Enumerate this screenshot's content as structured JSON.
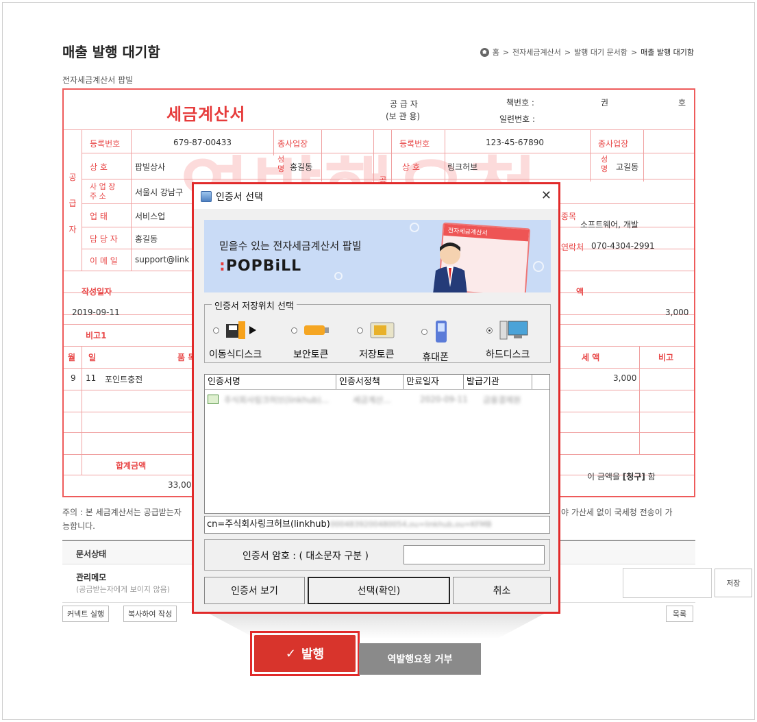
{
  "page": {
    "title": "매출 발행 대기함",
    "subtitle": "전자세금계산서 팝빌",
    "breadcrumb": [
      "홈",
      ">",
      "전자세금계산서",
      ">",
      "발행 대기 문서함",
      ">",
      "매출 발행 대기함"
    ]
  },
  "invoice": {
    "title": "세금계산서",
    "watermark": "역발행요청",
    "supplier_header": "공 급 자",
    "supplier_sub": "(보 관 용)",
    "book_no_label": "책번호 :",
    "serial_no_label": "일련번호 :",
    "book_unit1": "권",
    "book_unit2": "호",
    "supplier_side_label": [
      "공",
      "급",
      "자"
    ],
    "buyer_side_label": "공",
    "supplier": {
      "reg_no_label": "등록번호",
      "reg_no": "679-87-00433",
      "branch_label": "종사업장",
      "name_label": "상   호",
      "name": "팝빌상사",
      "ceo_label": [
        "성",
        "명"
      ],
      "ceo": "홍길동",
      "address_label": [
        "사 업 장",
        "주    소"
      ],
      "address": "서울시 강남구",
      "business_type_label": "업   태",
      "business_type": "서비스업",
      "manager_label": "담 당 자",
      "manager": "홍길동",
      "email_label": "이 메 일",
      "email": "support@link"
    },
    "buyer": {
      "reg_no_label": "등록번호",
      "reg_no": "123-45-67890",
      "branch_label": "종사업장",
      "name_label": "상   호",
      "name": "링크허브",
      "ceo_label": [
        "성",
        "명"
      ],
      "ceo": "고길동",
      "item_label": "종목",
      "item": "소프트웨어, 개발",
      "contact_label": "연락처",
      "contact": "070-4304-2991"
    },
    "write_date_label": "작성일자",
    "write_date": "2019-09-11",
    "tax_label": "액",
    "tax_total": "3,000",
    "remark_label": "비고1",
    "items_header": {
      "month": "월",
      "day": "일",
      "name": "품 목",
      "tax": "세 액",
      "note": "비고"
    },
    "items": [
      {
        "month": "9",
        "day": "11",
        "name": "포인트충전",
        "tax": "3,000"
      }
    ],
    "total_label": "합계금액",
    "total": "33,000",
    "claim_text_before": "이 금액을 ",
    "claim_text_bold": "[청구]",
    "claim_text_after": " 함"
  },
  "notice": {
    "left": "주의 : 본 세금계산서는 공급받는자",
    "right": "야 가산세 없이 국세청 전송이 가",
    "line2": "능합니다."
  },
  "status": {
    "doc_state_label": "문서상태",
    "memo_label": "관리메모",
    "memo_sub": "(공급받는자에게 보이지 않음)",
    "save_label": "저장"
  },
  "actions": {
    "connect_label": "커넥트 실행",
    "copy_label": "복사하여 작성",
    "list_label": "목록",
    "issue_label": "발행",
    "reject_label": "역발행요청 거부"
  },
  "dialog": {
    "title": "인증서 선택",
    "close": "✕",
    "banner_text": "믿을수 있는 전자세금계산서 팝빌",
    "banner_logo": "POPBiLL",
    "banner_doc_title": "전자세금계산서",
    "storage_group_title": "인증서 저장위치 선택",
    "storage_options": [
      {
        "label": "이동식디스크",
        "selected": false
      },
      {
        "label": "보안토큰",
        "selected": false
      },
      {
        "label": "저장토큰",
        "selected": false
      },
      {
        "label": "휴대폰",
        "selected": false
      },
      {
        "label": "하드디스크",
        "selected": true
      }
    ],
    "columns": [
      "인증서명",
      "인증서정책",
      "만료일자",
      "발급기관"
    ],
    "cert_row": [
      "주식회사링크허브(linkhub)...",
      "세금계산...",
      "2020-09-11",
      "금융결제원"
    ],
    "cn_value": "cn=주식회사링크허브(linkhub)",
    "cn_blurred": "0004839200480054,ou=linkhub,ou=KFMB",
    "password_label": "인증서 암호 : ( 대소문자 구분 )",
    "view_cert_label": "인증서 보기",
    "confirm_label": "선택(확인)",
    "cancel_label": "취소"
  },
  "colors": {
    "accent_red": "#e63b3b",
    "issue_button": "#d8342c",
    "reject_button": "#8a8a8a",
    "banner_bg": "#c9dbf6"
  }
}
